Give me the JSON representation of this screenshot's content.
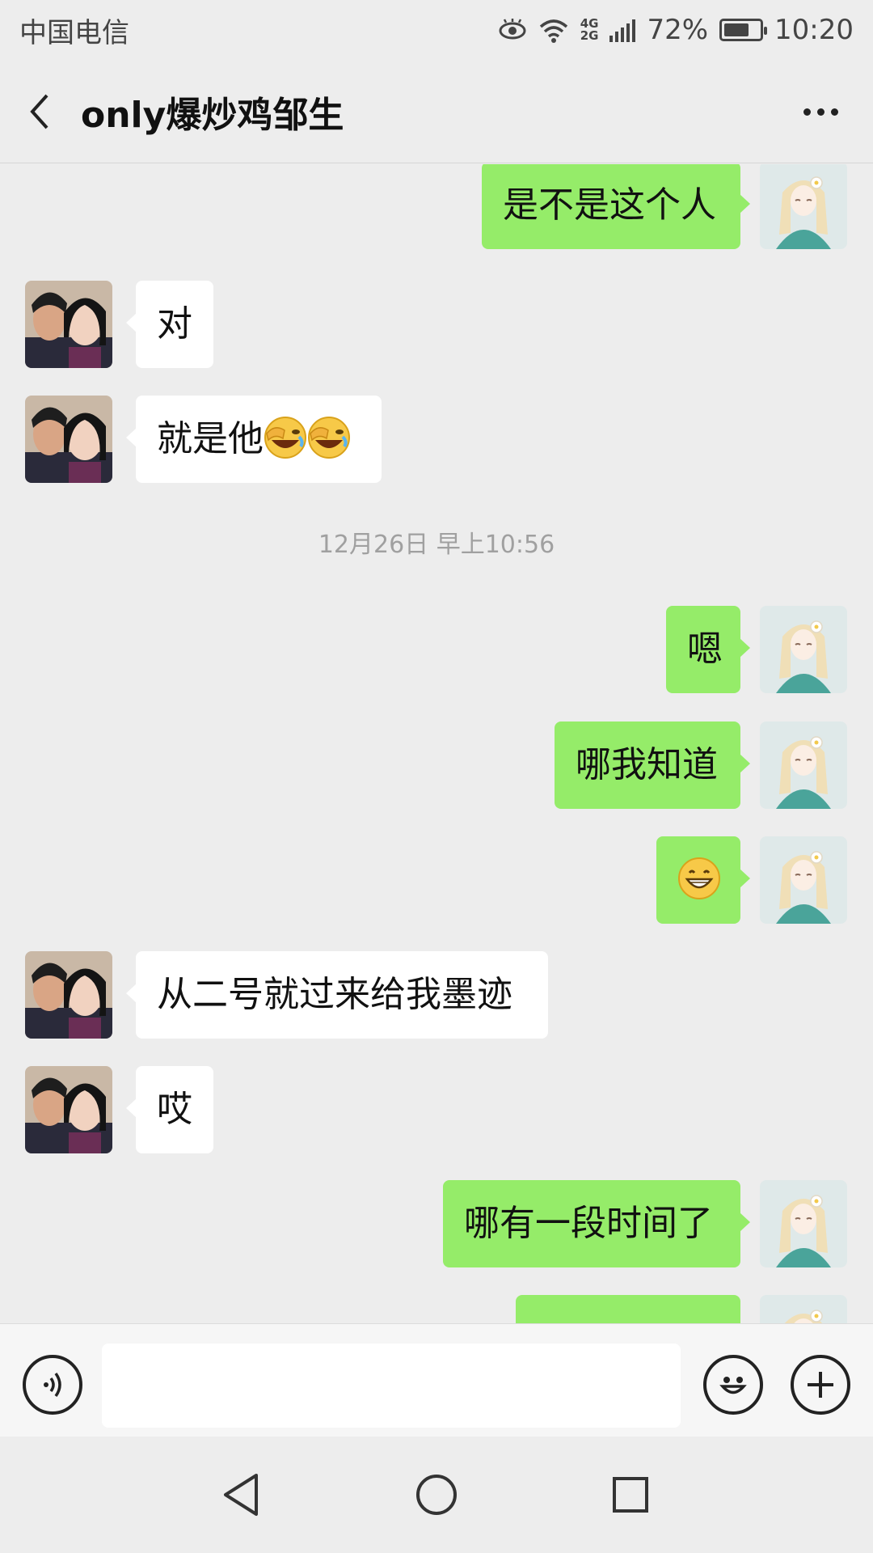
{
  "status_bar": {
    "carrier": "中国电信",
    "network_top": "4G",
    "network_bottom": "2G",
    "battery": "72%",
    "battery_level": 0.72,
    "time": "10:20"
  },
  "header": {
    "title": "only爆炒鸡邹生",
    "back_icon": "chevron-left-icon",
    "more_icon": "more-dots-icon"
  },
  "messages": [
    {
      "side": "out",
      "text": "是不是这个人"
    },
    {
      "side": "in",
      "text": "对"
    },
    {
      "side": "in",
      "text": "就是他",
      "emojis": [
        "facepalm-laugh-emoji",
        "facepalm-laugh-emoji"
      ]
    },
    {
      "type": "timestamp",
      "text": "12月26日 早上10:56"
    },
    {
      "side": "out",
      "text": "嗯"
    },
    {
      "side": "out",
      "text": "哪我知道"
    },
    {
      "side": "out",
      "text": "",
      "emojis": [
        "grin-emoji"
      ]
    },
    {
      "side": "in",
      "text": "从二号就过来给我墨迹"
    },
    {
      "side": "in",
      "text": "哎"
    },
    {
      "side": "out",
      "text": "哪有一段时间了"
    },
    {
      "side": "out",
      "text": ""
    }
  ],
  "input_bar": {
    "voice_icon": "voice-icon",
    "input_value": "",
    "emoji_icon": "smiley-icon",
    "plus_icon": "plus-icon"
  },
  "nav_bar": {
    "back_icon": "nav-back-icon",
    "home_icon": "nav-home-icon",
    "recents_icon": "nav-recents-icon"
  },
  "colors": {
    "background": "#ededed",
    "outgoing_bubble": "#95ec69",
    "incoming_bubble": "#ffffff",
    "timestamp_text": "#a0a0a0"
  }
}
